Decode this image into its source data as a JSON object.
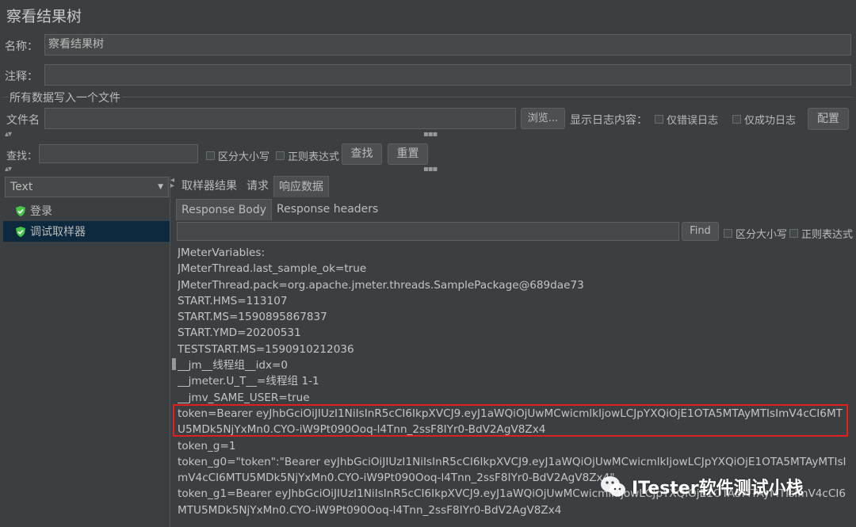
{
  "title": "察看结果树",
  "name_label": "名称：",
  "name_value": "察看结果树",
  "comment_label": "注释：",
  "comment_value": "",
  "file_section": {
    "legend": "所有数据写入一个文件",
    "filename_label": "文件名",
    "filename_value": "",
    "browse_label": "浏览...",
    "log_label": "显示日志内容：",
    "errors_only": "仅错误日志",
    "success_only": "仅成功日志",
    "configure": "配置"
  },
  "search": {
    "label": "查找：",
    "value": "",
    "case_sensitive": "区分大小写",
    "regex": "正则表达式",
    "find_button": "查找",
    "reset_button": "重置"
  },
  "renderer": {
    "selected": "Text"
  },
  "tree": {
    "items": [
      {
        "label": "登录",
        "status": "success"
      },
      {
        "label": "调试取样器",
        "status": "success"
      }
    ]
  },
  "tabs": [
    "取样器结果",
    "请求",
    "响应数据"
  ],
  "subtabs": [
    "Response Body",
    "Response headers"
  ],
  "response_search": {
    "value": "",
    "find_button": "Find",
    "case_sensitive": "区分大小写",
    "regex": "正则表达式"
  },
  "response_lines": [
    "JMeterVariables:",
    "JMeterThread.last_sample_ok=true",
    "JMeterThread.pack=org.apache.jmeter.threads.SamplePackage@689dae73",
    "START.HMS=113107",
    "START.MS=1590895867837",
    "START.YMD=20200531",
    "TESTSTART.MS=1590910212036",
    "__jm__线程组__idx=0",
    "__jmeter.U_T__=线程组 1-1",
    "__jmv_SAME_USER=true",
    "token=Bearer eyJhbGciOiJIUzI1NiIsInR5cCI6IkpXVCJ9.eyJ1aWQiOjUwMCwicmlkIjowLCJpYXQiOjE1OTA5MTAyMTIsImV4cCI6MT",
    "U5MDk5NjYxMn0.CYO-iW9Pt090Ooq-l4Tnn_2ssF8IYr0-BdV2AgV8Zx4",
    "token_g=1",
    "token_g0=\"token\":\"Bearer eyJhbGciOiJIUzI1NiIsInR5cCI6IkpXVCJ9.eyJ1aWQiOjUwMCwicmlkIjowLCJpYXQiOjE1OTA5MTAyMTIsI",
    "mV4cCI6MTU5MDk5NjYxMn0.CYO-iW9Pt090Ooq-l4Tnn_2ssF8IYr0-BdV2AgV8Zx4\"",
    "token_g1=Bearer eyJhbGciOiJIUzI1NiIsInR5cCI6IkpXVCJ9.eyJ1aWQiOjUwMCwicmlkIjowLCJpYXQiOjE1OTA5MTAyMTIsImV4cCI6",
    "MTU5MDk5NjYxMn0.CYO-iW9Pt090Ooq-l4Tnn_2ssF8IYr0-BdV2AgV8Zx4"
  ],
  "watermark": "ITester软件测试小栈",
  "colors": {
    "background": "#3c3f41",
    "highlight_box": "#e0201f",
    "selected_row": "#0d293e",
    "success_icon": "#47c647"
  }
}
